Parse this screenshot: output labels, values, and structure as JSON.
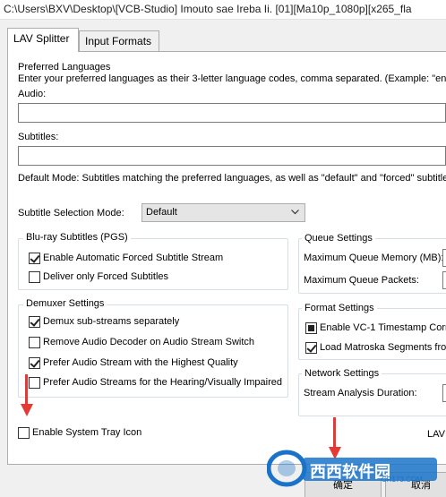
{
  "window": {
    "title": "C:\\Users\\BXV\\Desktop\\[VCB-Studio] Imouto sae Ireba Ii. [01][Ma10p_1080p][x265_fla"
  },
  "tabs": [
    {
      "label": "LAV Splitter",
      "active": true
    },
    {
      "label": "Input Formats",
      "active": false
    }
  ],
  "languages": {
    "heading": "Preferred Languages",
    "description": "Enter your preferred languages as their 3-letter language codes, comma separated. (Example: \"eng",
    "audio_label": "Audio:",
    "audio_value": "",
    "subtitles_label": "Subtitles:",
    "subtitles_value": "",
    "default_mode_text": "Default Mode: Subtitles matching the preferred languages, as well as \"default\" and \"forced\" subtitle"
  },
  "subtitle_selection": {
    "label": "Subtitle Selection Mode:",
    "value": "Default"
  },
  "bluray": {
    "title": "Blu-ray Subtitles (PGS)",
    "options": [
      {
        "label": "Enable Automatic Forced Subtitle Stream",
        "checked": true
      },
      {
        "label": "Deliver only Forced Subtitles",
        "checked": false
      }
    ]
  },
  "demuxer": {
    "title": "Demuxer Settings",
    "options": [
      {
        "label": "Demux sub-streams separately",
        "checked": true
      },
      {
        "label": "Remove Audio Decoder on Audio Stream Switch",
        "checked": false
      },
      {
        "label": "Prefer Audio Stream with the Highest Quality",
        "checked": true
      },
      {
        "label": "Prefer Audio Streams for the Hearing/Visually Impaired",
        "checked": false
      }
    ]
  },
  "queue": {
    "title": "Queue Settings",
    "memory_label": "Maximum Queue Memory (MB):",
    "packets_label": "Maximum Queue Packets:"
  },
  "format": {
    "title": "Format Settings",
    "options": [
      {
        "label": "Enable VC-1 Timestamp Corre",
        "state": "indeterminate"
      },
      {
        "label": "Load Matroska Segments from",
        "checked": true
      }
    ]
  },
  "network": {
    "title": "Network Settings",
    "analysis_label": "Stream Analysis Duration:"
  },
  "tray": {
    "label": "Enable System Tray Icon",
    "checked": false
  },
  "footer": {
    "lav_text": "LAV",
    "ok_label": "确定",
    "cancel_label": "取消"
  },
  "watermark": {
    "text": "西西软件园",
    "url_text": "CR173.COM"
  },
  "colors": {
    "arrow": "#e53935",
    "watermark": "#1a73c9"
  }
}
